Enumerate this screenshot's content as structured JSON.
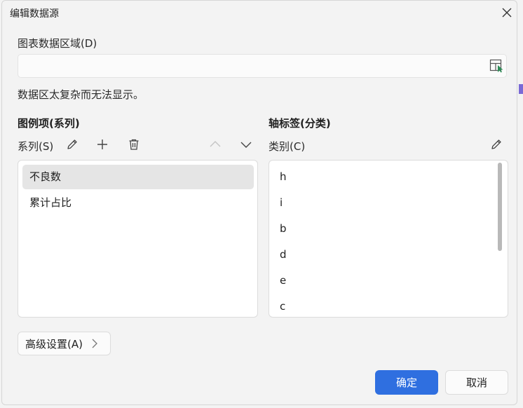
{
  "window": {
    "title": "编辑数据源"
  },
  "range": {
    "label": "图表数据区域(D)",
    "value": "",
    "message": "数据区太复杂而无法显示。"
  },
  "series_panel": {
    "title": "图例项(系列)",
    "sub_label": "系列(S)",
    "items": [
      {
        "label": "不良数",
        "selected": true
      },
      {
        "label": "累计占比",
        "selected": false
      }
    ]
  },
  "category_panel": {
    "title": "轴标签(分类)",
    "sub_label": "类别(C)",
    "items": [
      "h",
      "i",
      "b",
      "d",
      "e",
      "c"
    ]
  },
  "footer": {
    "advanced_label": "高级设置(A)",
    "ok_label": "确定",
    "cancel_label": "取消"
  },
  "colors": {
    "accent": "#2f6fe0",
    "selection": "#e5e5e5",
    "background": "#f3f3f3"
  }
}
